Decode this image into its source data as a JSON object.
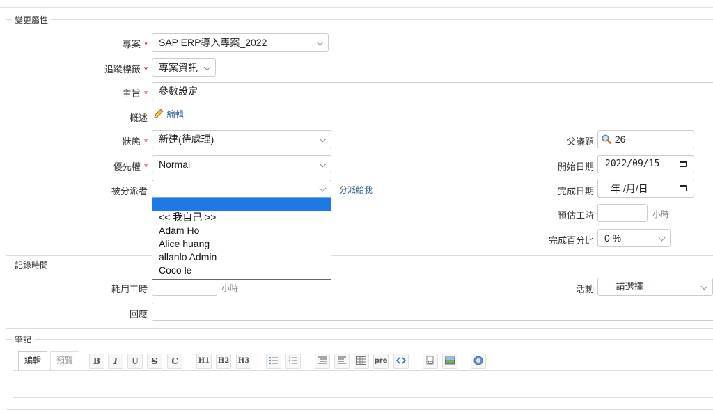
{
  "sections": {
    "change_attributes": "變更屬性",
    "time_log": "記錄時間",
    "notes": "筆記"
  },
  "project": {
    "label": "專案",
    "value": "SAP ERP導入專案_2022"
  },
  "tracker": {
    "label": "追蹤標籤",
    "value": "專案資訊"
  },
  "subject": {
    "label": "主旨",
    "value": "參數設定"
  },
  "description": {
    "label": "概述",
    "edit_link": "編輯"
  },
  "status": {
    "label": "狀態",
    "value": "新建(待處理)"
  },
  "priority": {
    "label": "優先權",
    "value": "Normal"
  },
  "assignee": {
    "label": "被分派者",
    "value": "",
    "assign_to_me": "分派給我",
    "options": [
      "",
      "<< 我自己 >>",
      "Adam Ho",
      "Alice huang",
      "allanlo Admin",
      "Coco le"
    ]
  },
  "parent_issue": {
    "label": "父議題",
    "value": "26"
  },
  "start_date": {
    "label": "開始日期",
    "value": "2022/09/15"
  },
  "due_date": {
    "label": "完成日期",
    "value": "年 /月/日"
  },
  "estimated_hours": {
    "label": "預估工時",
    "unit": "小時",
    "value": ""
  },
  "done_ratio": {
    "label": "完成百分比",
    "value": "0 %"
  },
  "required_mark": "*",
  "time_entry": {
    "hours_label": "耗用工時",
    "hours_unit": "小時",
    "activity_label": "活動",
    "activity_value": "--- 請選擇 ---",
    "comment_label": "回應"
  },
  "editor_tabs": {
    "edit": "編輯",
    "preview": "預覽"
  },
  "toolbar": {
    "bold": "B",
    "italic": "I",
    "underline": "U",
    "strike": "S",
    "code": "C",
    "h1": "H1",
    "h2": "H2",
    "h3": "H3",
    "pre": "pre"
  },
  "colors": {
    "required": "#bb0000",
    "link": "#2a5a8a",
    "highlight": "#1e78e6"
  }
}
